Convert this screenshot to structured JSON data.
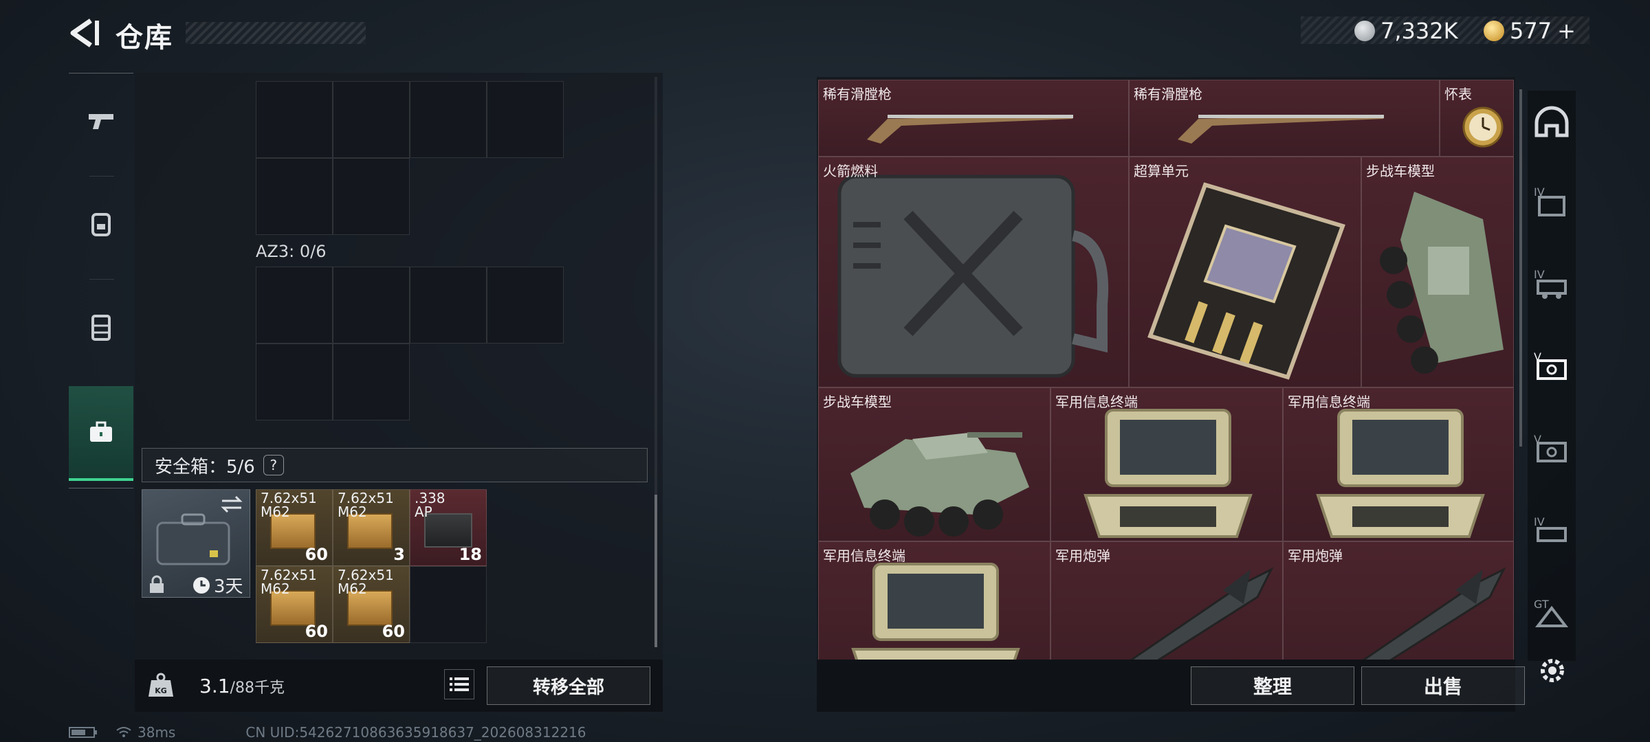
{
  "header": {
    "title": "仓库",
    "currency_silver": "7,332K",
    "currency_gold": "577",
    "currency_plus": "+"
  },
  "left_panel": {
    "az3_label": "AZ3: 0/6",
    "safe_box_label": "安全箱：5/6",
    "help_label": "?",
    "safe_case_timer": "3天",
    "ammo": [
      {
        "label": "7.62x51\nM62",
        "count": "60",
        "tone": "gold"
      },
      {
        "label": "7.62x51\nM62",
        "count": "3",
        "tone": "gold"
      },
      {
        "label": ".338\nAP",
        "count": "18",
        "tone": "red"
      },
      {
        "label": "7.62x51\nM62",
        "count": "60",
        "tone": "gold"
      },
      {
        "label": "7.62x51\nM62",
        "count": "60",
        "tone": "gold"
      }
    ],
    "weight_value": "3.1",
    "weight_capacity": "/88千克",
    "transfer_all": "转移全部"
  },
  "right_panel": {
    "items": [
      {
        "name": "稀有滑膛枪",
        "icon": "musket"
      },
      {
        "name": "稀有滑膛枪",
        "icon": "musket"
      },
      {
        "name": "怀表",
        "icon": "pocket-watch"
      },
      {
        "name": "火箭燃料",
        "icon": "fuel-can"
      },
      {
        "name": "超算单元",
        "icon": "circuit-board"
      },
      {
        "name": "步战车模型",
        "icon": "ifv-model"
      },
      {
        "name": "步战车模型",
        "icon": "ifv-model"
      },
      {
        "name": "军用信息终端",
        "icon": "terminal"
      },
      {
        "name": "军用信息终端",
        "icon": "terminal"
      },
      {
        "name": "军用信息终端",
        "icon": "terminal"
      },
      {
        "name": "军用炮弹",
        "icon": "shell"
      },
      {
        "name": "军用炮弹",
        "icon": "shell"
      }
    ],
    "sort_label": "整理",
    "sell_label": "出售"
  },
  "right_nav": [
    "helmet-icon",
    "IV",
    "IV",
    "V",
    "V",
    "IV",
    "GT"
  ],
  "status": {
    "ping": "38ms",
    "uid": "CN UID:5426271086363591863​7_202608312216"
  },
  "colors": {
    "accent_green": "#3fd28f",
    "item_bg": "#4b242d",
    "gold_ammo": "#52452c"
  }
}
